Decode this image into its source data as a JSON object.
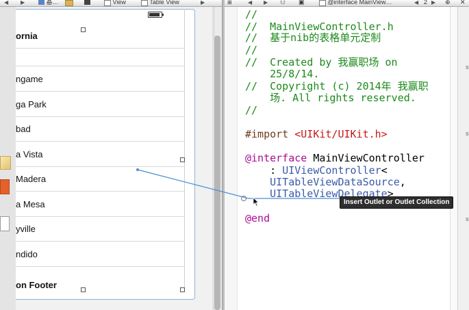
{
  "jumpbar": {
    "left_segments": [
      "基…",
      "View",
      "Table View"
    ],
    "right_file": "@interface MainView…",
    "counter": "2"
  },
  "storyboard": {
    "header": "ornia",
    "cells": [
      "ngame",
      "ga Park",
      "bad",
      "a Vista",
      "Madera",
      "a Mesa",
      "yville",
      "ndido"
    ],
    "footer": "on Footer"
  },
  "editor": {
    "lines": [
      "//",
      "//  MainViewController.h",
      "//  基于nib的表格单元定制",
      "//",
      "//  Created by 我赢职场 on",
      "    25/8/14.",
      "//  Copyright (c) 2014年 我赢职",
      "    场. All rights reserved.",
      "//",
      "",
      "#import ",
      "<UIKit/UIKit.h>",
      "@interface ",
      "MainViewController",
      "    : ",
      "UIViewController",
      "<",
      "    UITableViewDataSource",
      ",",
      "    UITableViewDelegate",
      ">",
      "@end"
    ]
  },
  "tooltip": "Insert Outlet or Outlet Collection",
  "colors": {
    "comment": "#1b8a1b",
    "keyword": "#aa0d91",
    "string": "#c41a16",
    "class": "#3b5aa8",
    "preprocessor": "#6e3b1c",
    "connection": "#4a8fd4"
  }
}
